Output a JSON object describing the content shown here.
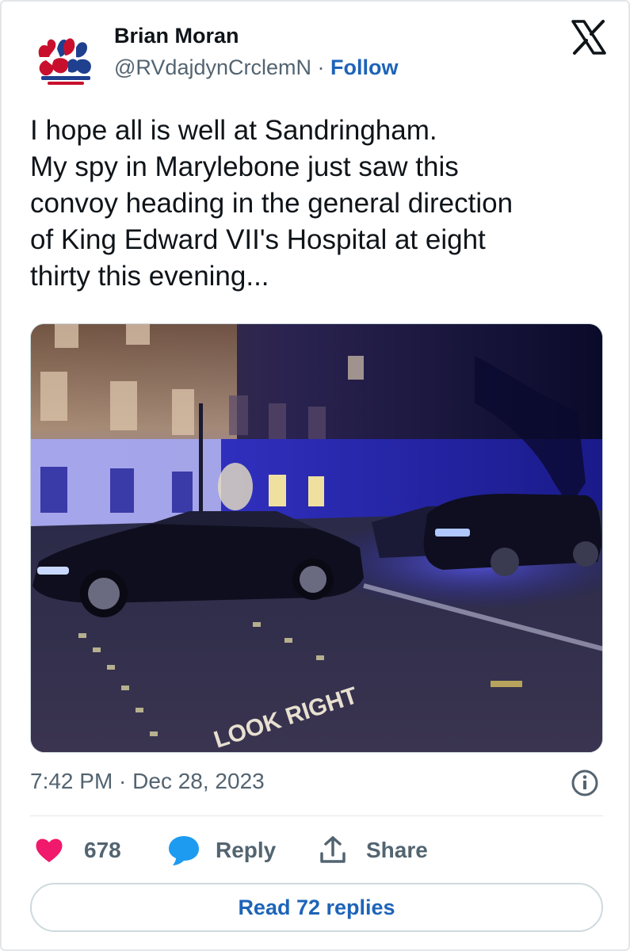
{
  "author": {
    "name": "Brian Moran",
    "handle": "@RVdajdynCrclemN",
    "separator": "·",
    "follow_label": "Follow"
  },
  "tweet": {
    "lines": [
      "I hope all is well at Sandringham.",
      "My spy in Marylebone just saw this",
      "convoy heading in the general direction",
      "of King Edward VII's Hospital at eight",
      "thirty this evening..."
    ],
    "media_road_text": "LOOK RIGHT",
    "timestamp": "7:42 PM · Dec 28, 2023"
  },
  "actions": {
    "like_count": "678",
    "reply_label": "Reply",
    "share_label": "Share",
    "read_replies_label": "Read 72 replies"
  },
  "icons": {
    "platform": "x-logo-icon",
    "like": "heart-icon",
    "reply": "speech-bubble-icon",
    "share": "share-upload-icon",
    "info": "info-icon"
  },
  "colors": {
    "link": "#1d64b8",
    "like_heart": "#f0196c",
    "reply_bubble": "#1d9bf0",
    "secondary_text": "#536471"
  }
}
